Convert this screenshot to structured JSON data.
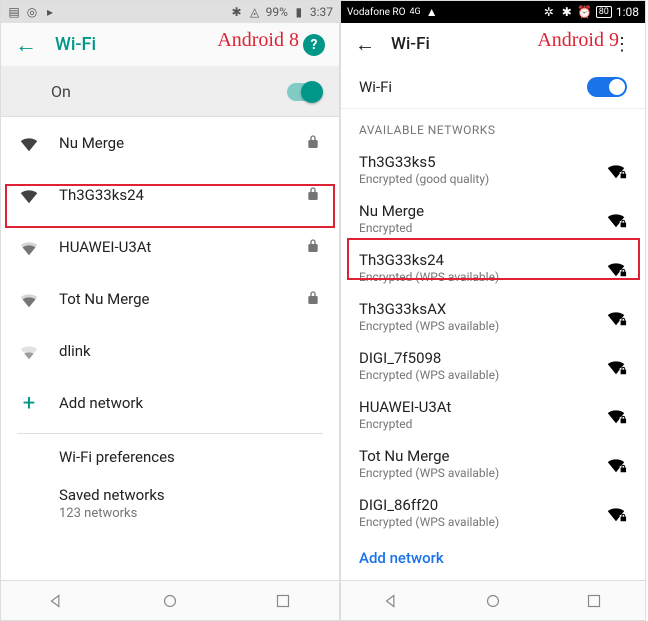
{
  "labels": {
    "a8": "Android 8",
    "a9": "Android 9"
  },
  "a8": {
    "status": {
      "battery": "99%",
      "time": "3:37"
    },
    "header": {
      "title": "Wi-Fi"
    },
    "on_label": "On",
    "networks": [
      {
        "name": "Nu Merge",
        "signal": 4,
        "locked": true,
        "highlighted": false
      },
      {
        "name": "Th3G33ks24",
        "signal": 4,
        "locked": true,
        "highlighted": true
      },
      {
        "name": "HUAWEI-U3At",
        "signal": 3,
        "locked": true,
        "highlighted": false
      },
      {
        "name": "Tot Nu Merge",
        "signal": 3,
        "locked": true,
        "highlighted": false
      },
      {
        "name": "dlink",
        "signal": 2,
        "locked": false,
        "highlighted": false
      }
    ],
    "add_network": "Add network",
    "prefs": [
      {
        "title": "Wi-Fi preferences",
        "subtitle": ""
      },
      {
        "title": "Saved networks",
        "subtitle": "123 networks"
      }
    ]
  },
  "a9": {
    "status": {
      "carrier": "Vodafone RO",
      "net": "4G",
      "battery": "80",
      "time": "1:08"
    },
    "header": {
      "title": "Wi-Fi"
    },
    "wifi_label": "Wi-Fi",
    "section": "AVAILABLE NETWORKS",
    "networks": [
      {
        "name": "Th3G33ks5",
        "sub": "Encrypted (good quality)",
        "highlighted": false
      },
      {
        "name": "Nu Merge",
        "sub": "Encrypted",
        "highlighted": false
      },
      {
        "name": "Th3G33ks24",
        "sub": "Encrypted (WPS available)",
        "highlighted": true
      },
      {
        "name": "Th3G33ksAX",
        "sub": "Encrypted (WPS available)",
        "highlighted": false
      },
      {
        "name": "DIGI_7f5098",
        "sub": "Encrypted (WPS available)",
        "highlighted": false
      },
      {
        "name": "HUAWEI-U3At",
        "sub": "Encrypted",
        "highlighted": false
      },
      {
        "name": "Tot Nu Merge",
        "sub": "Encrypted (WPS available)",
        "highlighted": false
      },
      {
        "name": "DIGI_86ff20",
        "sub": "Encrypted (WPS available)",
        "highlighted": false
      }
    ],
    "add_network": "Add network"
  }
}
